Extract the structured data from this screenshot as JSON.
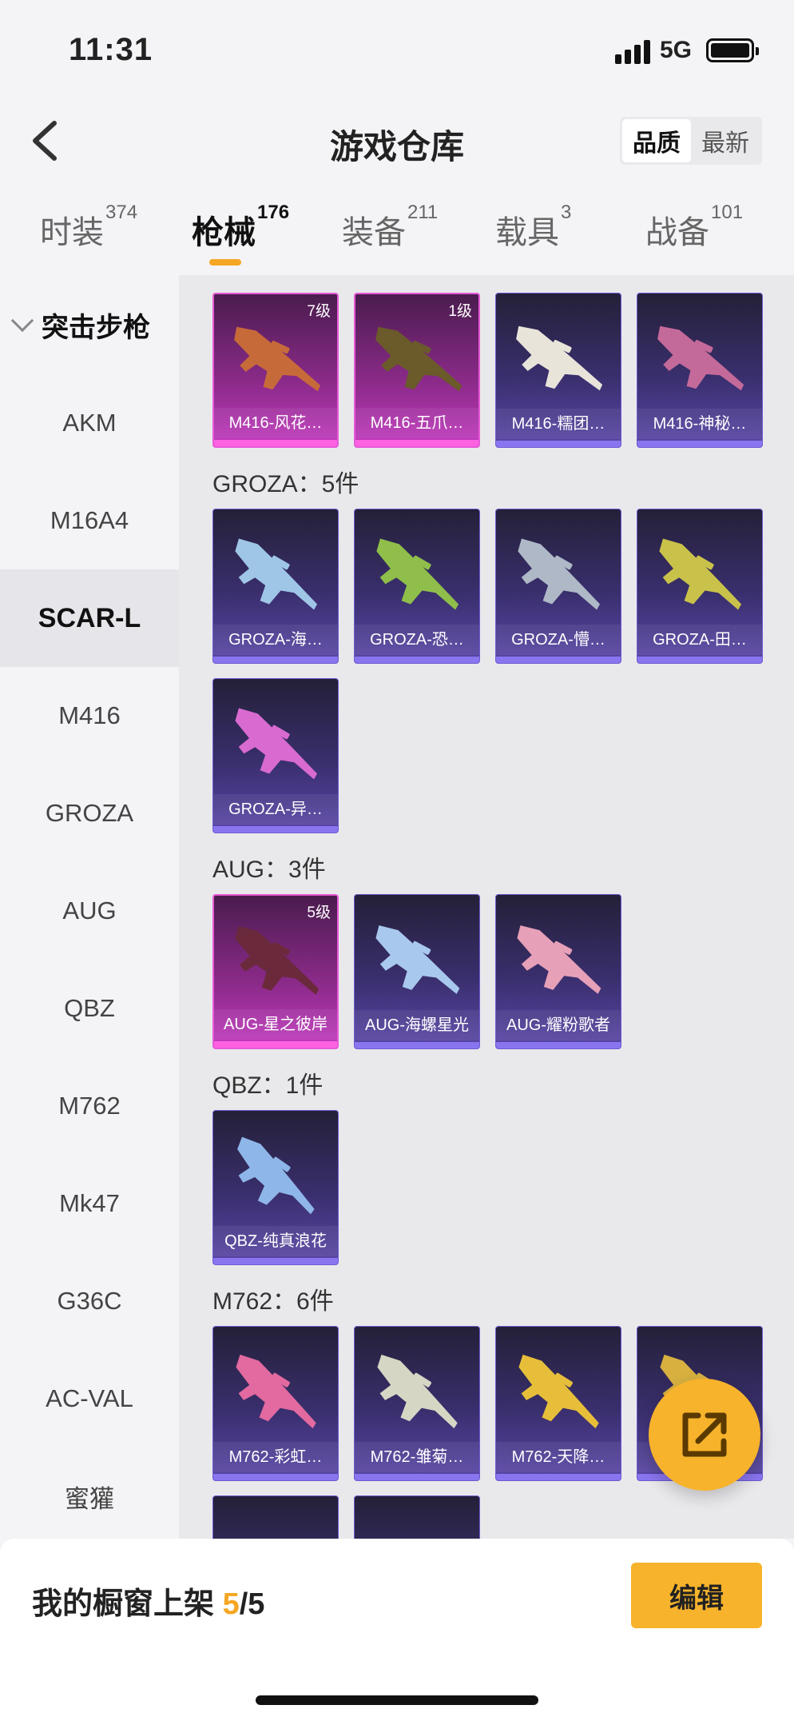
{
  "status_bar": {
    "time": "11:31",
    "network": "5G"
  },
  "header": {
    "title": "游戏仓库",
    "sort": [
      "品质",
      "最新"
    ]
  },
  "tabs": [
    {
      "label": "时装",
      "count": "374"
    },
    {
      "label": "枪械",
      "count": "176"
    },
    {
      "label": "装备",
      "count": "211"
    },
    {
      "label": "载具",
      "count": "3"
    },
    {
      "label": "战备",
      "count": "101"
    }
  ],
  "menu": {
    "group": "突击步枪",
    "items": [
      "AKM",
      "M16A4",
      "SCAR-L",
      "M416",
      "GROZA",
      "AUG",
      "QBZ",
      "M762",
      "Mk47",
      "G36C",
      "AC-VAL",
      "蜜獾"
    ]
  },
  "sections": {
    "m416": {
      "items": [
        {
          "name": "M416-风花…",
          "level": "7级"
        },
        {
          "name": "M416-五爪…",
          "level": "1级"
        },
        {
          "name": "M416-糯团…"
        },
        {
          "name": "M416-神秘…"
        }
      ]
    },
    "groza": {
      "title": "GROZA：5件",
      "items": [
        {
          "name": "GROZA-海…"
        },
        {
          "name": "GROZA-恐…"
        },
        {
          "name": "GROZA-懵…"
        },
        {
          "name": "GROZA-田…"
        },
        {
          "name": "GROZA-异…"
        }
      ]
    },
    "aug": {
      "title": "AUG：3件",
      "items": [
        {
          "name": "AUG-星之彼岸",
          "level": "5级"
        },
        {
          "name": "AUG-海螺星光"
        },
        {
          "name": "AUG-耀粉歌者"
        }
      ]
    },
    "qbz": {
      "title": "QBZ：1件",
      "items": [
        {
          "name": "QBZ-纯真浪花"
        }
      ]
    },
    "m762": {
      "title": "M762：6件",
      "items": [
        {
          "name": "M762-彩虹…"
        },
        {
          "name": "M762-雏菊…"
        },
        {
          "name": "M762-天降…"
        },
        {
          "name": "M…"
        }
      ]
    }
  },
  "bottom": {
    "label": "我的橱窗上架",
    "count": "5",
    "total": "/5",
    "edit": "编辑"
  },
  "colors": {
    "accent": "#f5a623",
    "legendary": "#e65ad7",
    "epic": "#6d5bd0"
  }
}
